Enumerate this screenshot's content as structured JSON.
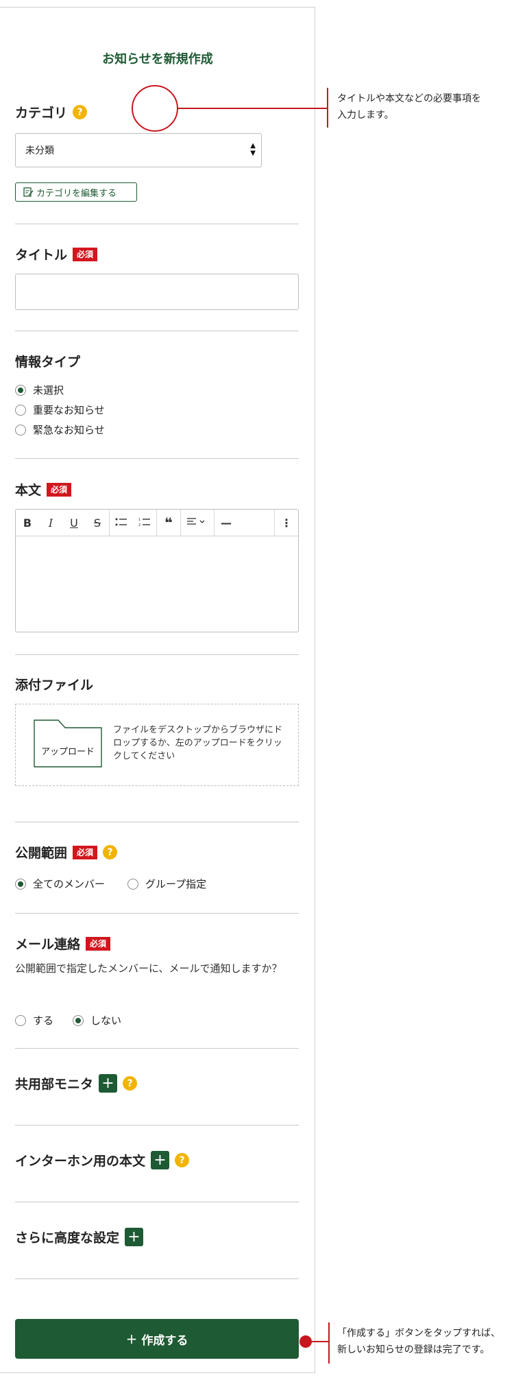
{
  "page_title": "お知らせを新規作成",
  "category": {
    "label": "カテゴリ",
    "selected": "未分類",
    "edit_button": "カテゴリを編集する"
  },
  "title_section": {
    "label": "タイトル",
    "required": "必須",
    "value": ""
  },
  "info_type": {
    "label": "情報タイプ",
    "options": [
      "未選択",
      "重要なお知らせ",
      "緊急なお知らせ"
    ],
    "selected_index": 0
  },
  "body": {
    "label": "本文",
    "required": "必須"
  },
  "attachment": {
    "label": "添付ファイル",
    "upload_label": "アップロード",
    "drop_text": "ファイルをデスクトップからブラウザにドロップするか、左のアップロードをクリックしてください"
  },
  "scope": {
    "label": "公開範囲",
    "required": "必須",
    "options": [
      "全てのメンバー",
      "グループ指定"
    ],
    "selected_index": 0
  },
  "mail": {
    "label": "メール連絡",
    "required": "必須",
    "description": "公開範囲で指定したメンバーに、メールで通知しますか？",
    "options": [
      "する",
      "しない"
    ],
    "selected_index": 1
  },
  "shared_monitor": {
    "label": "共用部モニタ"
  },
  "intercom": {
    "label": "インターホン用の本文"
  },
  "advanced": {
    "label": "さらに高度な設定"
  },
  "create_button": {
    "icon": "+",
    "label": "作成する"
  },
  "annotations": {
    "top_line1": "タイトルや本文などの必要事項を",
    "top_line2": "入力します。",
    "bottom_line1": "「作成する」ボタンをタップすれば、",
    "bottom_line2": "新しいお知らせの登録は完了です。"
  },
  "colors": {
    "accent": "#1e5a33",
    "required": "#d2161e",
    "help": "#f1b400",
    "annotation": "#c8161e"
  }
}
